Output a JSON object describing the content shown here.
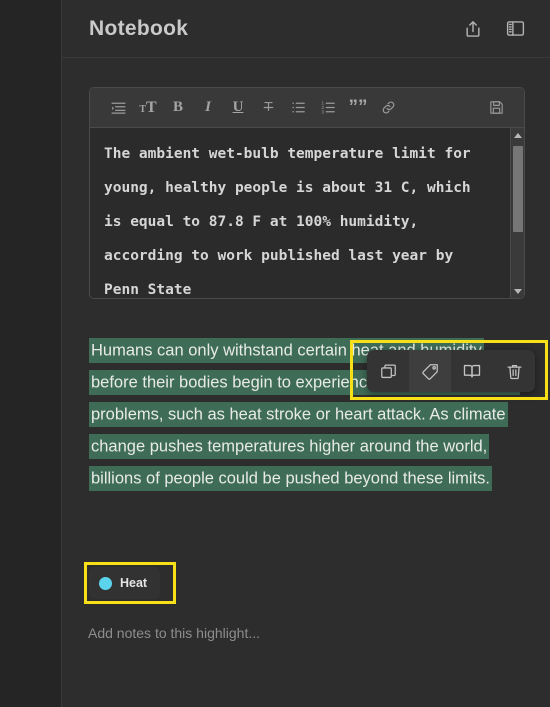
{
  "header": {
    "title": "Notebook",
    "actions": [
      {
        "name": "share-icon",
        "label": "Share"
      },
      {
        "name": "notebook-panel-icon",
        "label": "Toggle notebook panel"
      }
    ]
  },
  "editor": {
    "toolbar": [
      {
        "name": "indent-icon",
        "label": "Indent"
      },
      {
        "name": "text-size-icon",
        "label": "Text size",
        "small": "T",
        "large": "T"
      },
      {
        "name": "bold-icon",
        "label": "B"
      },
      {
        "name": "italic-icon",
        "label": "I"
      },
      {
        "name": "underline-icon",
        "label": "U"
      },
      {
        "name": "strikethrough-icon",
        "label": "Strikethrough"
      },
      {
        "name": "bullet-list-icon",
        "label": "Bulleted list"
      },
      {
        "name": "numbered-list-icon",
        "label": "Numbered list"
      },
      {
        "name": "quote-icon",
        "label": "””"
      },
      {
        "name": "link-icon",
        "label": "Link"
      },
      {
        "name": "save-icon",
        "label": "Save"
      }
    ],
    "content": "The ambient wet-bulb temperature limit for young, healthy people is about 31 C, which is equal to 87.8 F at 100% humidity, according to work published last year by Penn State",
    "scrollbar": {
      "up_label": "Scroll up",
      "down_label": "Scroll down"
    }
  },
  "highlight": {
    "text": "Humans can only withstand certain heat and humidity before their bodies begin to experience heat-related health problems, such as heat stroke or heart attack. As climate change pushes temperatures higher around the world, billions of people could be pushed beyond these limits.",
    "color": "#3f6c57",
    "tag": {
      "label": "Heat",
      "dot_color": "#5cd3ec"
    },
    "notes_placeholder": "Add notes to this highlight..."
  },
  "float_toolbar": {
    "buttons": [
      {
        "name": "copy-icon",
        "label": "Copy",
        "active": false
      },
      {
        "name": "tag-icon",
        "label": "Tag",
        "active": true
      },
      {
        "name": "book-icon",
        "label": "Open book",
        "active": false
      },
      {
        "name": "trash-icon",
        "label": "Delete",
        "active": false
      }
    ]
  },
  "annotations": {
    "highlight_color": "#f7e018",
    "boxes": [
      {
        "name": "annotation-box-float-toolbar"
      },
      {
        "name": "annotation-box-tag"
      }
    ]
  }
}
